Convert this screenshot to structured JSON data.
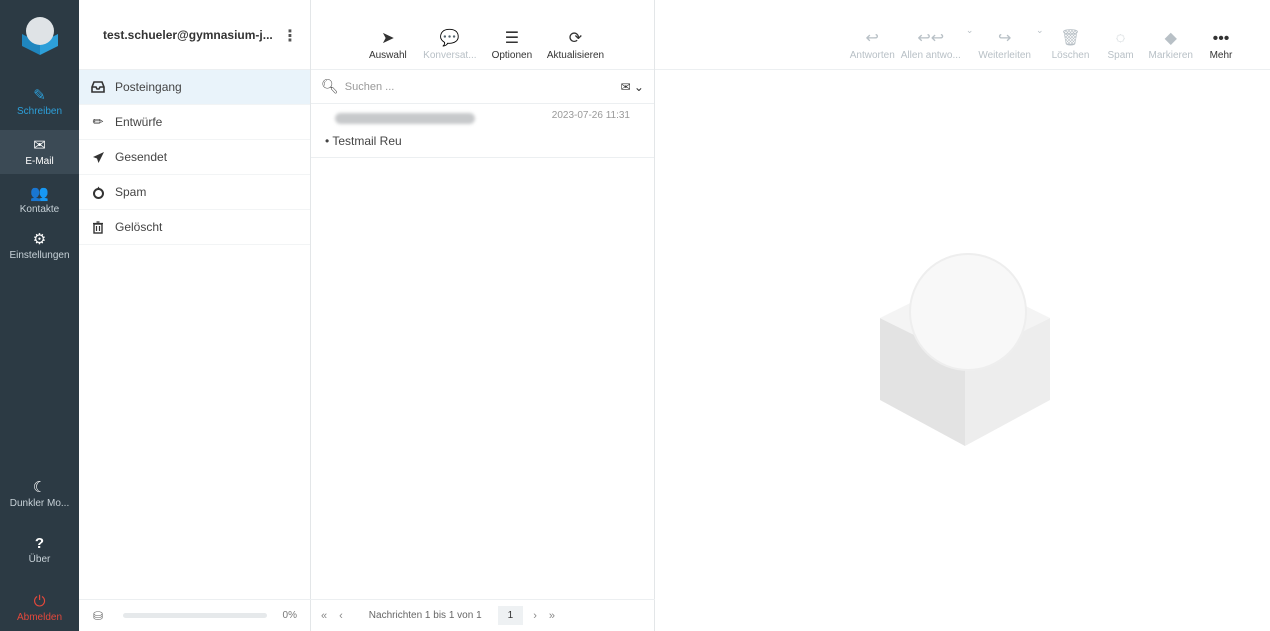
{
  "nav": {
    "compose": "Schreiben",
    "mail": "E-Mail",
    "contacts": "Kontakte",
    "settings": "Einstellungen",
    "dark_mode": "Dunkler Mo...",
    "about": "Über",
    "logout": "Abmelden"
  },
  "account": {
    "email": "test.schueler@gymnasium-j..."
  },
  "folders": [
    {
      "label": "Posteingang",
      "icon": "inbox-icon"
    },
    {
      "label": "Entwürfe",
      "icon": "pencil-icon"
    },
    {
      "label": "Gesendet",
      "icon": "paper-plane-icon"
    },
    {
      "label": "Spam",
      "icon": "fire-icon"
    },
    {
      "label": "Gelöscht",
      "icon": "trash-icon"
    }
  ],
  "quota": {
    "percent_label": "0%",
    "fraction": 0
  },
  "list_toolbar": {
    "select": "Auswahl",
    "conversation": "Konversat...",
    "options": "Optionen",
    "refresh": "Aktualisieren"
  },
  "search": {
    "placeholder": "Suchen ..."
  },
  "messages": [
    {
      "date": "2023-07-26 11:31",
      "subject": "Testmail Reu"
    }
  ],
  "pager": {
    "first": "«",
    "prev": "‹",
    "info": "Nachrichten 1 bis 1 von 1",
    "page": "1",
    "next": "›",
    "last": "»"
  },
  "reader_toolbar": {
    "reply": "Antworten",
    "reply_all": "Allen antwo...",
    "forward": "Weiterleiten",
    "delete": "Löschen",
    "spam": "Spam",
    "mark": "Markieren",
    "more": "Mehr"
  },
  "colors": {
    "nav_bg": "#2c3a44",
    "accent": "#2d9fd9",
    "logout": "#e5483b",
    "selected_folder": "#e9f3fa"
  }
}
